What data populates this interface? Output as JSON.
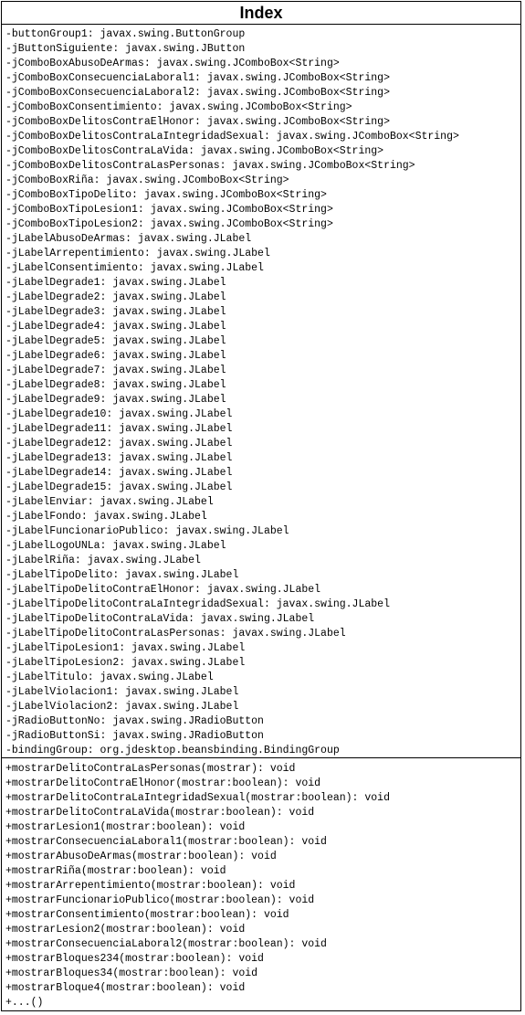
{
  "class": {
    "name": "Index",
    "attributes": [
      "-buttonGroup1: javax.swing.ButtonGroup",
      "-jButtonSiguiente: javax.swing.JButton",
      "-jComboBoxAbusoDeArmas: javax.swing.JComboBox<String>",
      "-jComboBoxConsecuenciaLaboral1: javax.swing.JComboBox<String>",
      "-jComboBoxConsecuenciaLaboral2: javax.swing.JComboBox<String>",
      "-jComboBoxConsentimiento: javax.swing.JComboBox<String>",
      "-jComboBoxDelitosContraElHonor: javax.swing.JComboBox<String>",
      "-jComboBoxDelitosContraLaIntegridadSexual: javax.swing.JComboBox<String>",
      "-jComboBoxDelitosContraLaVida: javax.swing.JComboBox<String>",
      "-jComboBoxDelitosContraLasPersonas: javax.swing.JComboBox<String>",
      "-jComboBoxRiña: javax.swing.JComboBox<String>",
      "-jComboBoxTipoDelito: javax.swing.JComboBox<String>",
      "-jComboBoxTipoLesion1: javax.swing.JComboBox<String>",
      "-jComboBoxTipoLesion2: javax.swing.JComboBox<String>",
      "-jLabelAbusoDeArmas: javax.swing.JLabel",
      "-jLabelArrepentimiento: javax.swing.JLabel",
      "-jLabelConsentimiento: javax.swing.JLabel",
      "-jLabelDegrade1: javax.swing.JLabel",
      "-jLabelDegrade2: javax.swing.JLabel",
      "-jLabelDegrade3: javax.swing.JLabel",
      "-jLabelDegrade4: javax.swing.JLabel",
      "-jLabelDegrade5: javax.swing.JLabel",
      "-jLabelDegrade6: javax.swing.JLabel",
      "-jLabelDegrade7: javax.swing.JLabel",
      "-jLabelDegrade8: javax.swing.JLabel",
      "-jLabelDegrade9: javax.swing.JLabel",
      "-jLabelDegrade10: javax.swing.JLabel",
      "-jLabelDegrade11: javax.swing.JLabel",
      "-jLabelDegrade12: javax.swing.JLabel",
      "-jLabelDegrade13: javax.swing.JLabel",
      "-jLabelDegrade14: javax.swing.JLabel",
      "-jLabelDegrade15: javax.swing.JLabel",
      "-jLabelEnviar: javax.swing.JLabel",
      "-jLabelFondo: javax.swing.JLabel",
      "-jLabelFuncionarioPublico: javax.swing.JLabel",
      "-jLabelLogoUNLa: javax.swing.JLabel",
      "-jLabelRiña: javax.swing.JLabel",
      "-jLabelTipoDelito: javax.swing.JLabel",
      "-jLabelTipoDelitoContraElHonor: javax.swing.JLabel",
      "-jLabelTipoDelitoContraLaIntegridadSexual: javax.swing.JLabel",
      "-jLabelTipoDelitoContraLaVida: javax.swing.JLabel",
      "-jLabelTipoDelitoContraLasPersonas: javax.swing.JLabel",
      "-jLabelTipoLesion1: javax.swing.JLabel",
      "-jLabelTipoLesion2: javax.swing.JLabel",
      "-jLabelTitulo: javax.swing.JLabel",
      "-jLabelViolacion1: javax.swing.JLabel",
      "-jLabelViolacion2: javax.swing.JLabel",
      "-jRadioButtonNo: javax.swing.JRadioButton",
      "-jRadioButtonSi: javax.swing.JRadioButton",
      "-bindingGroup: org.jdesktop.beansbinding.BindingGroup"
    ],
    "operations": [
      "+mostrarDelitoContraLasPersonas(mostrar): void",
      "+mostrarDelitoContraElHonor(mostrar:boolean): void",
      "+mostrarDelitoContraLaIntegridadSexual(mostrar:boolean): void",
      "+mostrarDelitoContraLaVida(mostrar:boolean): void",
      "+mostrarLesion1(mostrar:boolean): void",
      "+mostrarConsecuenciaLaboral1(mostrar:boolean): void",
      "+mostrarAbusoDeArmas(mostrar:boolean): void",
      "+mostrarRiña(mostrar:boolean): void",
      "+mostrarArrepentimiento(mostrar:boolean): void",
      "+mostrarFuncionarioPublico(mostrar:boolean): void",
      "+mostrarConsentimiento(mostrar:boolean): void",
      "+mostrarLesion2(mostrar:boolean): void",
      "+mostrarConsecuenciaLaboral2(mostrar:boolean): void",
      "+mostrarBloques234(mostrar:boolean): void",
      "+mostrarBloques34(mostrar:boolean): void",
      "+mostrarBloque4(mostrar:boolean): void",
      "+...()"
    ]
  }
}
